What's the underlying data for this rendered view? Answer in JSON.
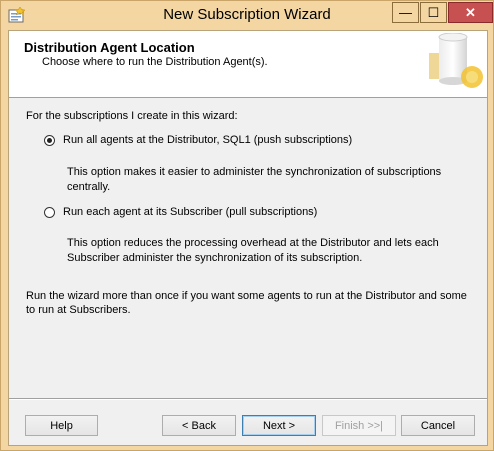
{
  "window": {
    "title": "New Subscription Wizard",
    "controls": {
      "minimize": "—",
      "maximize": "☐",
      "close": "✕"
    }
  },
  "header": {
    "title": "Distribution Agent Location",
    "subtitle": "Choose where to run the Distribution Agent(s)."
  },
  "content": {
    "intro": "For the subscriptions I create in this wizard:",
    "option_push": {
      "label": "Run all agents at the Distributor, SQL1 (push subscriptions)",
      "selected": true,
      "description": "This option makes it easier to administer the synchronization of subscriptions centrally."
    },
    "option_pull": {
      "label": "Run each agent at its Subscriber (pull subscriptions)",
      "selected": false,
      "description": "This option reduces the processing overhead at the Distributor and lets each Subscriber administer the synchronization of its subscription."
    },
    "note": "Run the wizard more than once if you want some agents to run at the Distributor and some to run at Subscribers."
  },
  "buttons": {
    "help": "Help",
    "back": "< Back",
    "next": "Next >",
    "finish": "Finish >>|",
    "cancel": "Cancel"
  },
  "colors": {
    "titlebar": "#f4d6a2",
    "close": "#c75050"
  }
}
